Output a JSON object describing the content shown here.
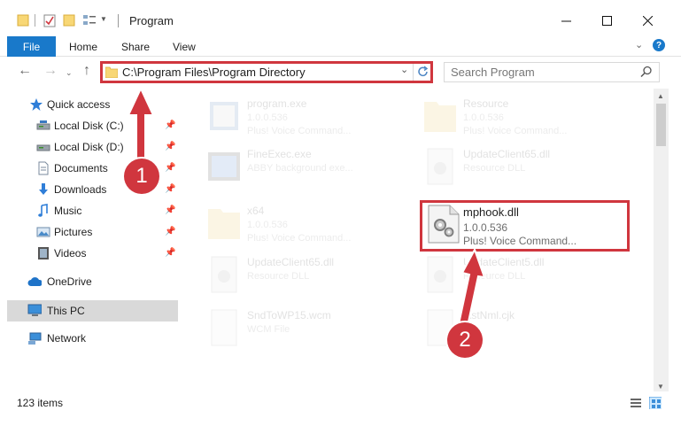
{
  "window": {
    "title": "Program"
  },
  "ribbon": {
    "file": "File",
    "home": "Home",
    "share": "Share",
    "view": "View",
    "help": "?"
  },
  "address": {
    "path": "C:\\Program Files\\Program Directory"
  },
  "search": {
    "placeholder": "Search Program"
  },
  "sidebar": {
    "quick_access": "Quick access",
    "items": [
      {
        "label": "Local Disk (C:)",
        "icon": "drive-icon",
        "pinned": true
      },
      {
        "label": "Local Disk (D:)",
        "icon": "drive-icon",
        "pinned": true
      },
      {
        "label": "Documents",
        "icon": "documents-icon",
        "pinned": true
      },
      {
        "label": "Downloads",
        "icon": "downloads-icon",
        "pinned": true
      },
      {
        "label": "Music",
        "icon": "music-icon",
        "pinned": true
      },
      {
        "label": "Pictures",
        "icon": "pictures-icon",
        "pinned": true
      },
      {
        "label": "Videos",
        "icon": "videos-icon",
        "pinned": true
      }
    ],
    "onedrive": "OneDrive",
    "this_pc": "This PC",
    "network": "Network"
  },
  "files": [
    {
      "name": "program.exe",
      "line2": "1.0.0.536",
      "line3": "Plus! Voice Command..."
    },
    {
      "name": "Resource",
      "line2": "1.0.0.536",
      "line3": "Plus! Voice Command..."
    },
    {
      "name": "FineExec.exe",
      "line2": "ABBY background exe...",
      "line3": ""
    },
    {
      "name": "UpdateClient65.dll",
      "line2": "Resource DLL",
      "line3": ""
    },
    {
      "name": "x64",
      "line2": "1.0.0.536",
      "line3": "Plus! Voice Command..."
    },
    {
      "name": "mphook.dll",
      "line2": "1.0.0.536",
      "line3": "Plus! Voice Command..."
    },
    {
      "name": "UpdateClient65.dll",
      "line2": "Resource DLL",
      "line3": ""
    },
    {
      "name": "UpdateClient5.dll",
      "line2": "Resource DLL",
      "line3": ""
    },
    {
      "name": "SndToWP15.wcm",
      "line2": "WCM File",
      "line3": ""
    },
    {
      "name": "lastNml.cjk",
      "line2": "File",
      "line3": ""
    }
  ],
  "status": {
    "count": "123 items"
  },
  "annotations": {
    "step1": "1",
    "step2": "2"
  },
  "colors": {
    "accent": "#1979ca",
    "highlight": "#d0363e",
    "selected": "#cce8ff"
  }
}
